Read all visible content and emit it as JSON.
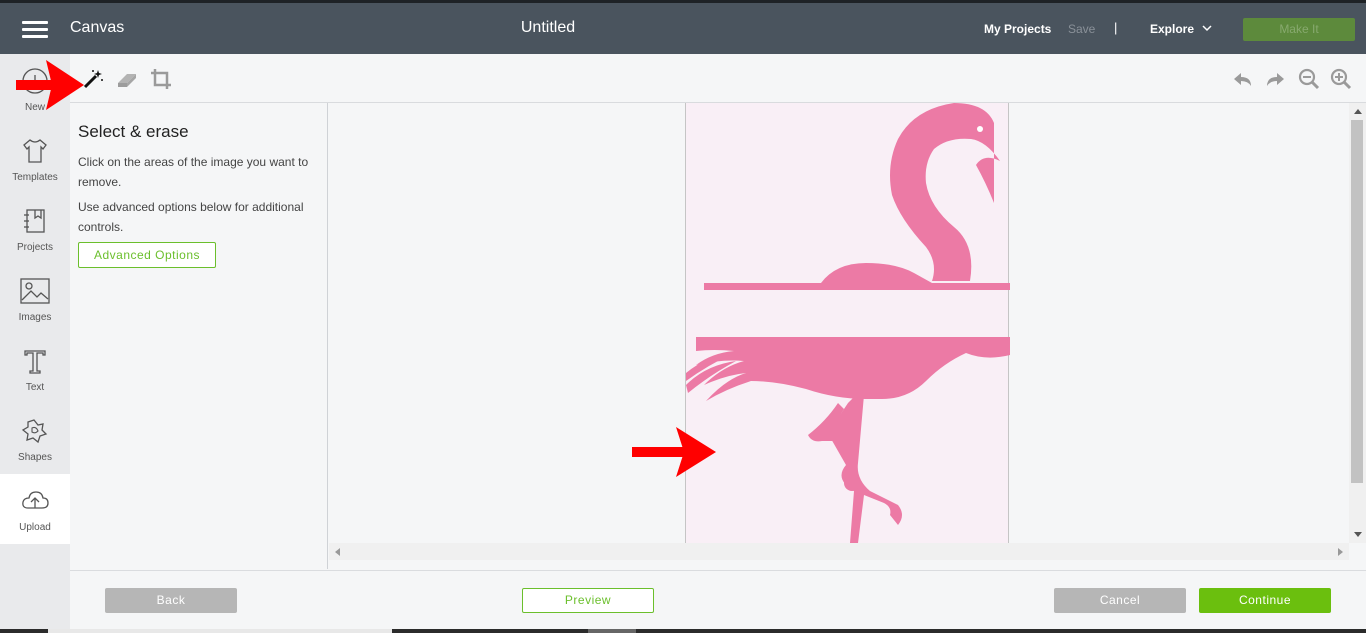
{
  "header": {
    "app_title": "Canvas",
    "doc_title": "Untitled",
    "my_projects": "My Projects",
    "save": "Save",
    "separator": "|",
    "explore": "Explore",
    "make_it": "Make It"
  },
  "rail": {
    "items": [
      {
        "label": "New",
        "icon": "plus-circle-icon"
      },
      {
        "label": "Templates",
        "icon": "shirt-icon"
      },
      {
        "label": "Projects",
        "icon": "notebook-icon"
      },
      {
        "label": "Images",
        "icon": "image-icon"
      },
      {
        "label": "Text",
        "icon": "text-t-icon"
      },
      {
        "label": "Shapes",
        "icon": "shapes-icon"
      },
      {
        "label": "Upload",
        "icon": "cloud-upload-icon"
      }
    ]
  },
  "tools": {
    "left": [
      "magic-wand-icon",
      "eraser-icon",
      "crop-icon"
    ],
    "right": [
      "undo-icon",
      "redo-icon",
      "zoom-out-icon",
      "zoom-in-icon"
    ]
  },
  "panel": {
    "title": "Select & erase",
    "para1": "Click on the areas of the image you want to remove.",
    "para2": "Use advanced options below for additional controls.",
    "advanced_options": "Advanced Options"
  },
  "footer": {
    "back": "Back",
    "preview": "Preview",
    "cancel": "Cancel",
    "continue": "Continue"
  },
  "colors": {
    "header_bg": "#4a545e",
    "accent_green": "#6bbf0e",
    "flamingo_pink": "#ec7aa5",
    "annotation_red": "#ff0000"
  }
}
